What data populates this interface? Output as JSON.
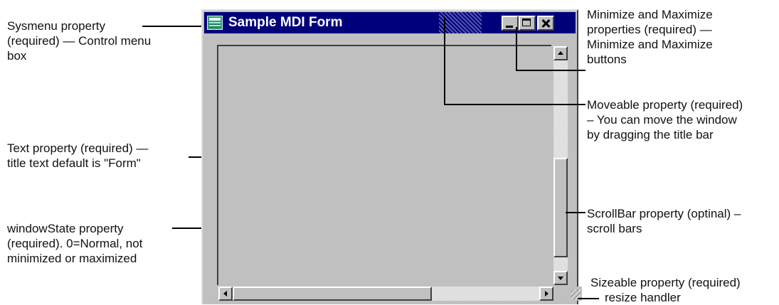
{
  "window": {
    "title": "Sample MDI Form"
  },
  "annotations": {
    "sysmenu": [
      "Sysmenu property",
      "(required) — Control menu",
      "box"
    ],
    "text_property": [
      "Text property (required) —",
      "title text default is \"Form\""
    ],
    "window_state": [
      "windowState property",
      "(required). 0=Normal, not",
      "minimized or maximized"
    ],
    "min_max": [
      "Minimize and Maximize",
      "properties (required) —",
      "Minimize and Maximize",
      "buttons"
    ],
    "moveable": [
      "Moveable property (required)",
      "– You can move the window",
      "by dragging the title bar"
    ],
    "scrollbar": [
      "ScrollBar property (optinal) –",
      "scroll bars"
    ],
    "sizeable": [
      "Sizeable property (required)",
      "resize handler"
    ]
  },
  "icons": [
    "control-menu-icon",
    "minimize-icon",
    "maximize-icon",
    "close-icon",
    "scroll-up-arrow-icon",
    "scroll-down-arrow-icon",
    "scroll-left-arrow-icon",
    "scroll-right-arrow-icon",
    "resize-grip-icon"
  ],
  "colors": {
    "titlebar": "#00007b",
    "window_face": "#c0c0c0",
    "title_text": "#ffffff"
  }
}
